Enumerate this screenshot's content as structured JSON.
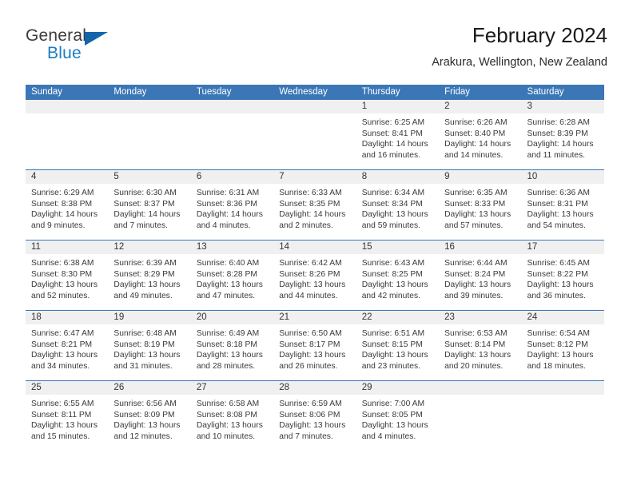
{
  "brand": {
    "line1": "General",
    "line2": "Blue",
    "accent_color": "#1b7cc6",
    "triangle_color": "#1565ad"
  },
  "header": {
    "title": "February 2024",
    "subtitle": "Arakura, Wellington, New Zealand"
  },
  "theme": {
    "header_blue": "#3b77b6",
    "daynum_band": "#f0f0f0",
    "text": "#3a3a3a"
  },
  "weekdays": [
    "Sunday",
    "Monday",
    "Tuesday",
    "Wednesday",
    "Thursday",
    "Friday",
    "Saturday"
  ],
  "weeks": [
    [
      {
        "day": "",
        "lines": []
      },
      {
        "day": "",
        "lines": []
      },
      {
        "day": "",
        "lines": []
      },
      {
        "day": "",
        "lines": []
      },
      {
        "day": "1",
        "lines": [
          "Sunrise: 6:25 AM",
          "Sunset: 8:41 PM",
          "Daylight: 14 hours",
          "and 16 minutes."
        ]
      },
      {
        "day": "2",
        "lines": [
          "Sunrise: 6:26 AM",
          "Sunset: 8:40 PM",
          "Daylight: 14 hours",
          "and 14 minutes."
        ]
      },
      {
        "day": "3",
        "lines": [
          "Sunrise: 6:28 AM",
          "Sunset: 8:39 PM",
          "Daylight: 14 hours",
          "and 11 minutes."
        ]
      }
    ],
    [
      {
        "day": "4",
        "lines": [
          "Sunrise: 6:29 AM",
          "Sunset: 8:38 PM",
          "Daylight: 14 hours",
          "and 9 minutes."
        ]
      },
      {
        "day": "5",
        "lines": [
          "Sunrise: 6:30 AM",
          "Sunset: 8:37 PM",
          "Daylight: 14 hours",
          "and 7 minutes."
        ]
      },
      {
        "day": "6",
        "lines": [
          "Sunrise: 6:31 AM",
          "Sunset: 8:36 PM",
          "Daylight: 14 hours",
          "and 4 minutes."
        ]
      },
      {
        "day": "7",
        "lines": [
          "Sunrise: 6:33 AM",
          "Sunset: 8:35 PM",
          "Daylight: 14 hours",
          "and 2 minutes."
        ]
      },
      {
        "day": "8",
        "lines": [
          "Sunrise: 6:34 AM",
          "Sunset: 8:34 PM",
          "Daylight: 13 hours",
          "and 59 minutes."
        ]
      },
      {
        "day": "9",
        "lines": [
          "Sunrise: 6:35 AM",
          "Sunset: 8:33 PM",
          "Daylight: 13 hours",
          "and 57 minutes."
        ]
      },
      {
        "day": "10",
        "lines": [
          "Sunrise: 6:36 AM",
          "Sunset: 8:31 PM",
          "Daylight: 13 hours",
          "and 54 minutes."
        ]
      }
    ],
    [
      {
        "day": "11",
        "lines": [
          "Sunrise: 6:38 AM",
          "Sunset: 8:30 PM",
          "Daylight: 13 hours",
          "and 52 minutes."
        ]
      },
      {
        "day": "12",
        "lines": [
          "Sunrise: 6:39 AM",
          "Sunset: 8:29 PM",
          "Daylight: 13 hours",
          "and 49 minutes."
        ]
      },
      {
        "day": "13",
        "lines": [
          "Sunrise: 6:40 AM",
          "Sunset: 8:28 PM",
          "Daylight: 13 hours",
          "and 47 minutes."
        ]
      },
      {
        "day": "14",
        "lines": [
          "Sunrise: 6:42 AM",
          "Sunset: 8:26 PM",
          "Daylight: 13 hours",
          "and 44 minutes."
        ]
      },
      {
        "day": "15",
        "lines": [
          "Sunrise: 6:43 AM",
          "Sunset: 8:25 PM",
          "Daylight: 13 hours",
          "and 42 minutes."
        ]
      },
      {
        "day": "16",
        "lines": [
          "Sunrise: 6:44 AM",
          "Sunset: 8:24 PM",
          "Daylight: 13 hours",
          "and 39 minutes."
        ]
      },
      {
        "day": "17",
        "lines": [
          "Sunrise: 6:45 AM",
          "Sunset: 8:22 PM",
          "Daylight: 13 hours",
          "and 36 minutes."
        ]
      }
    ],
    [
      {
        "day": "18",
        "lines": [
          "Sunrise: 6:47 AM",
          "Sunset: 8:21 PM",
          "Daylight: 13 hours",
          "and 34 minutes."
        ]
      },
      {
        "day": "19",
        "lines": [
          "Sunrise: 6:48 AM",
          "Sunset: 8:19 PM",
          "Daylight: 13 hours",
          "and 31 minutes."
        ]
      },
      {
        "day": "20",
        "lines": [
          "Sunrise: 6:49 AM",
          "Sunset: 8:18 PM",
          "Daylight: 13 hours",
          "and 28 minutes."
        ]
      },
      {
        "day": "21",
        "lines": [
          "Sunrise: 6:50 AM",
          "Sunset: 8:17 PM",
          "Daylight: 13 hours",
          "and 26 minutes."
        ]
      },
      {
        "day": "22",
        "lines": [
          "Sunrise: 6:51 AM",
          "Sunset: 8:15 PM",
          "Daylight: 13 hours",
          "and 23 minutes."
        ]
      },
      {
        "day": "23",
        "lines": [
          "Sunrise: 6:53 AM",
          "Sunset: 8:14 PM",
          "Daylight: 13 hours",
          "and 20 minutes."
        ]
      },
      {
        "day": "24",
        "lines": [
          "Sunrise: 6:54 AM",
          "Sunset: 8:12 PM",
          "Daylight: 13 hours",
          "and 18 minutes."
        ]
      }
    ],
    [
      {
        "day": "25",
        "lines": [
          "Sunrise: 6:55 AM",
          "Sunset: 8:11 PM",
          "Daylight: 13 hours",
          "and 15 minutes."
        ]
      },
      {
        "day": "26",
        "lines": [
          "Sunrise: 6:56 AM",
          "Sunset: 8:09 PM",
          "Daylight: 13 hours",
          "and 12 minutes."
        ]
      },
      {
        "day": "27",
        "lines": [
          "Sunrise: 6:58 AM",
          "Sunset: 8:08 PM",
          "Daylight: 13 hours",
          "and 10 minutes."
        ]
      },
      {
        "day": "28",
        "lines": [
          "Sunrise: 6:59 AM",
          "Sunset: 8:06 PM",
          "Daylight: 13 hours",
          "and 7 minutes."
        ]
      },
      {
        "day": "29",
        "lines": [
          "Sunrise: 7:00 AM",
          "Sunset: 8:05 PM",
          "Daylight: 13 hours",
          "and 4 minutes."
        ]
      },
      {
        "day": "",
        "lines": []
      },
      {
        "day": "",
        "lines": []
      }
    ]
  ]
}
